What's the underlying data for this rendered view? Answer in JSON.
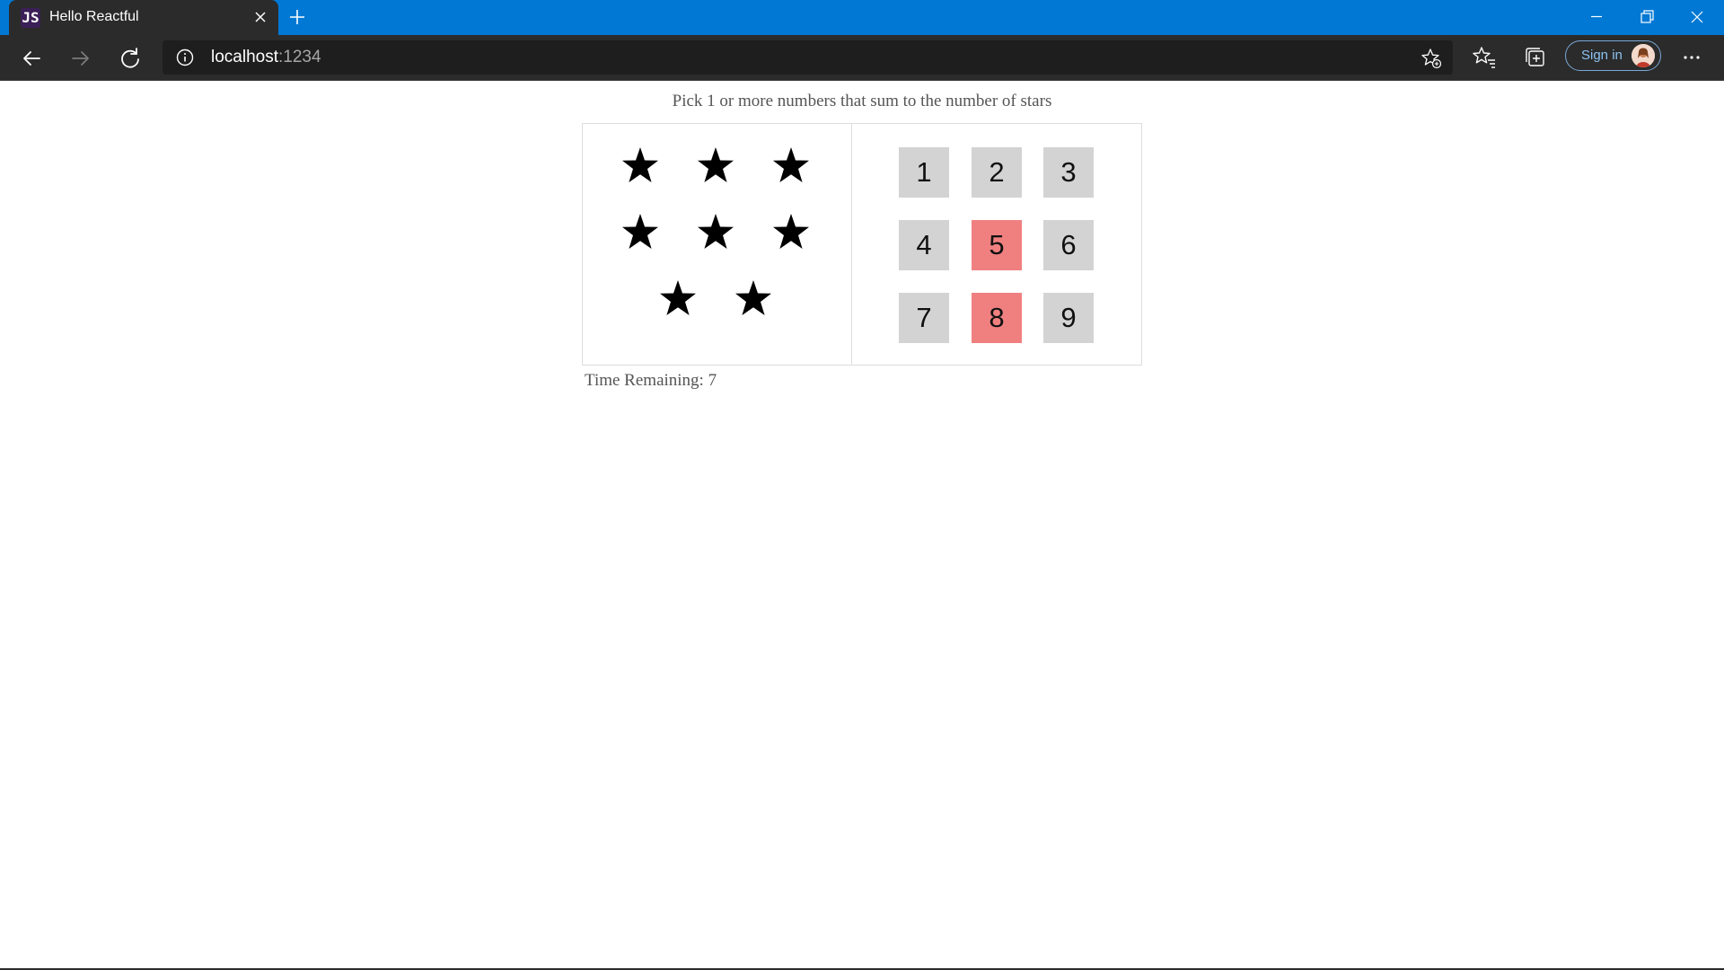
{
  "browser": {
    "tab_title": "Hello Reactful",
    "favicon_text": "JS",
    "url_host": "localhost",
    "url_port": ":1234",
    "signin_label": "Sign in",
    "accent_color": "#0078d4"
  },
  "game": {
    "instructions": "Pick 1 or more numbers that sum to the number of stars",
    "star_count": 8,
    "star_glyph": "★",
    "numbers": [
      {
        "label": "1",
        "status": "available",
        "color": "#d3d3d3"
      },
      {
        "label": "2",
        "status": "available",
        "color": "#d3d3d3"
      },
      {
        "label": "3",
        "status": "available",
        "color": "#d3d3d3"
      },
      {
        "label": "4",
        "status": "available",
        "color": "#d3d3d3"
      },
      {
        "label": "5",
        "status": "wrong",
        "color": "#f08080"
      },
      {
        "label": "6",
        "status": "available",
        "color": "#d3d3d3"
      },
      {
        "label": "7",
        "status": "available",
        "color": "#d3d3d3"
      },
      {
        "label": "8",
        "status": "wrong",
        "color": "#f08080"
      },
      {
        "label": "9",
        "status": "available",
        "color": "#d3d3d3"
      }
    ],
    "timer_label": "Time Remaining:",
    "timer_value": "7"
  }
}
